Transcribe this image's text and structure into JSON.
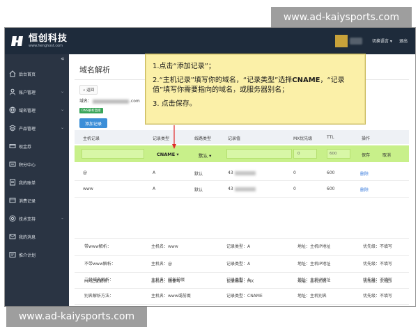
{
  "brand": {
    "name": "恒创科技",
    "url": "www.henghost.com"
  },
  "header": {
    "language": "切换语言 ▾",
    "logout": "退出"
  },
  "sidebar": {
    "collapse": "«",
    "items": [
      {
        "label": "后台首页",
        "icon": "home-icon",
        "caret": ""
      },
      {
        "label": "账户管理",
        "icon": "user-icon",
        "caret": "⌄"
      },
      {
        "label": "域名管理",
        "icon": "globe-icon",
        "caret": "⌄"
      },
      {
        "label": "产品管理",
        "icon": "layers-icon",
        "caret": "⌄"
      },
      {
        "label": "现金券",
        "icon": "ticket-icon",
        "caret": ""
      },
      {
        "label": "积分中心",
        "icon": "points-icon",
        "caret": ""
      },
      {
        "label": "我的账单",
        "icon": "bill-icon",
        "caret": ""
      },
      {
        "label": "消费记录",
        "icon": "record-icon",
        "caret": ""
      },
      {
        "label": "技术支持",
        "icon": "support-icon",
        "caret": "⌄"
      },
      {
        "label": "我的消息",
        "icon": "message-icon",
        "caret": ""
      },
      {
        "label": "推介计划",
        "icon": "referral-icon",
        "caret": ""
      }
    ]
  },
  "main": {
    "title": "域名解析",
    "back": "« 返回",
    "domain_prefix": "域名：",
    "domain_suffix": ".com",
    "dns_badge": "DNS解析直接",
    "add_record": "添加记录",
    "columns": [
      "主机记录",
      "记录类型",
      "线路类型",
      "记录值",
      "MX优先级",
      "TTL",
      "操作"
    ],
    "edit_row": {
      "type": "CNAME ▾",
      "line": "默认 ▾",
      "mx": "0",
      "ttl": "600",
      "save": "保存",
      "cancel": "取消"
    },
    "records": [
      {
        "host": "@",
        "type": "A",
        "line": "默认",
        "value": "43",
        "mx": "0",
        "ttl": "600",
        "action": "删除"
      },
      {
        "host": "www",
        "type": "A",
        "line": "默认",
        "value": "43",
        "mx": "0",
        "ttl": "600",
        "action": "删除"
      }
    ],
    "examples": [
      [
        "带www解析：",
        "主机名：www",
        "记录类型：A",
        "地址：主机IP地址",
        "优先级：不填写"
      ],
      [
        "不带www解析：",
        "主机名：@",
        "记录类型：A",
        "地址：主机IP地址",
        "优先级：不填写"
      ],
      [
        "二级域名解析：",
        "主机名：域名前缀",
        "记录类型：A",
        "地址：主机IP地址",
        "优先级：不填写"
      ],
      [
        "别名解析方法：",
        "主机名：www或前缀",
        "记录类型：CNAME",
        "地址：主机别名",
        "优先级：不填写"
      ],
      [
        "MX记录解析：",
        "主机名：随便写",
        "记录类型：MX",
        "地址：主机别名",
        "优先级：10或5"
      ]
    ]
  },
  "callout": {
    "step1": "1.点击“添加记录”；",
    "step2_prefix": "2.“主机记录”填写你的域名，“记录类型”选择",
    "step2_bold": "CNAME",
    "step2_suffix": "，“记录值”填写你需要指向的域名，或服务器别名；",
    "step3": "3. 点击保存。"
  },
  "watermark": "www.ad-kaiysports.com",
  "colors": {
    "header": "#1e2b3b",
    "sidebar": "#2a3443",
    "add_button": "#3b8ed8",
    "edit_row": "#c8f08a",
    "callout": "#fbf0a8",
    "arrow": "#e02a2a",
    "delete_link": "#3b7ddd"
  }
}
